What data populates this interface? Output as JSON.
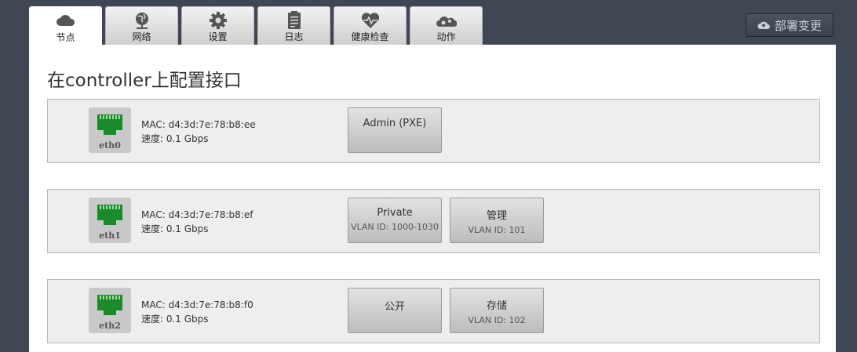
{
  "tabs": [
    {
      "label": "节点",
      "icon": "cloud-icon",
      "active": true
    },
    {
      "label": "网络",
      "icon": "network-globe-icon",
      "active": false
    },
    {
      "label": "设置",
      "icon": "gear-icon",
      "active": false
    },
    {
      "label": "日志",
      "icon": "clipboard-icon",
      "active": false
    },
    {
      "label": "健康检查",
      "icon": "heart-pulse-icon",
      "active": false
    },
    {
      "label": "动作",
      "icon": "gears-cloud-icon",
      "active": false
    }
  ],
  "deploy": {
    "label": "部署变更",
    "icon": "cloud-upload-icon"
  },
  "page_title": "在controller上配置接口",
  "interfaces": [
    {
      "name": "eth0",
      "mac": "MAC: d4:3d:7e:78:b8:ee",
      "speed": "速度: 0.1 Gbps",
      "networks": [
        {
          "name": "Admin (PXE)",
          "vlan": ""
        }
      ]
    },
    {
      "name": "eth1",
      "mac": "MAC: d4:3d:7e:78:b8:ef",
      "speed": "速度: 0.1 Gbps",
      "networks": [
        {
          "name": "Private",
          "vlan": "VLAN ID: 1000-1030"
        },
        {
          "name": "管理",
          "vlan": "VLAN ID: 101"
        }
      ]
    },
    {
      "name": "eth2",
      "mac": "MAC: d4:3d:7e:78:b8:f0",
      "speed": "速度: 0.1 Gbps",
      "networks": [
        {
          "name": "公开",
          "vlan": ""
        },
        {
          "name": "存储",
          "vlan": "VLAN ID: 102"
        }
      ]
    }
  ],
  "colors": {
    "port_green": "#1a8a2a",
    "panel_bg": "#eeeeee",
    "body_bg": "#3d4652"
  }
}
